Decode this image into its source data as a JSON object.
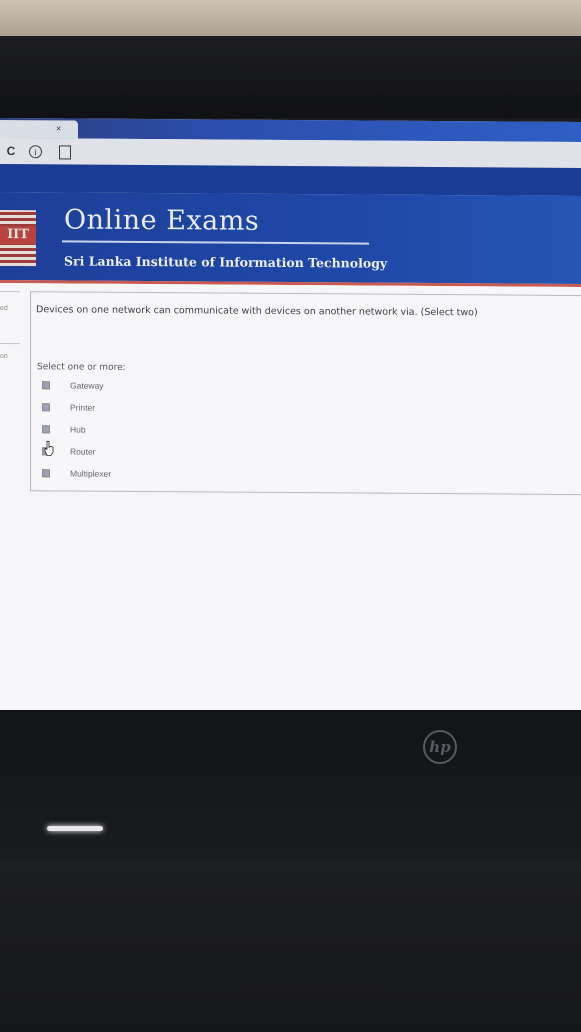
{
  "browser": {
    "tab_close": "×",
    "icons": [
      "reload-icon",
      "info-icon",
      "page-icon"
    ],
    "reload_glyph": "C",
    "info_glyph": "i"
  },
  "banner": {
    "logo_text": "IIT",
    "title": "Online Exams",
    "subtitle": "Sri Lanka Institute of Information Technology"
  },
  "sidebar": {
    "fragment_1": "ed",
    "fragment_2": "on"
  },
  "question": {
    "text": "Devices on one network can communicate with devices on another network via. (Select two)",
    "prompt": "Select one or more:",
    "options": [
      {
        "label": "Gateway",
        "checked": false
      },
      {
        "label": "Printer",
        "checked": false
      },
      {
        "label": "Hub",
        "checked": false
      },
      {
        "label": "Router",
        "checked": false
      },
      {
        "label": "Multiplexer",
        "checked": false
      }
    ]
  },
  "laptop": {
    "brand_logo": "hp"
  },
  "colors": {
    "banner_blue": "#1f48a8",
    "banner_accent": "#c95a52",
    "page_bg": "#f6f6f8"
  }
}
